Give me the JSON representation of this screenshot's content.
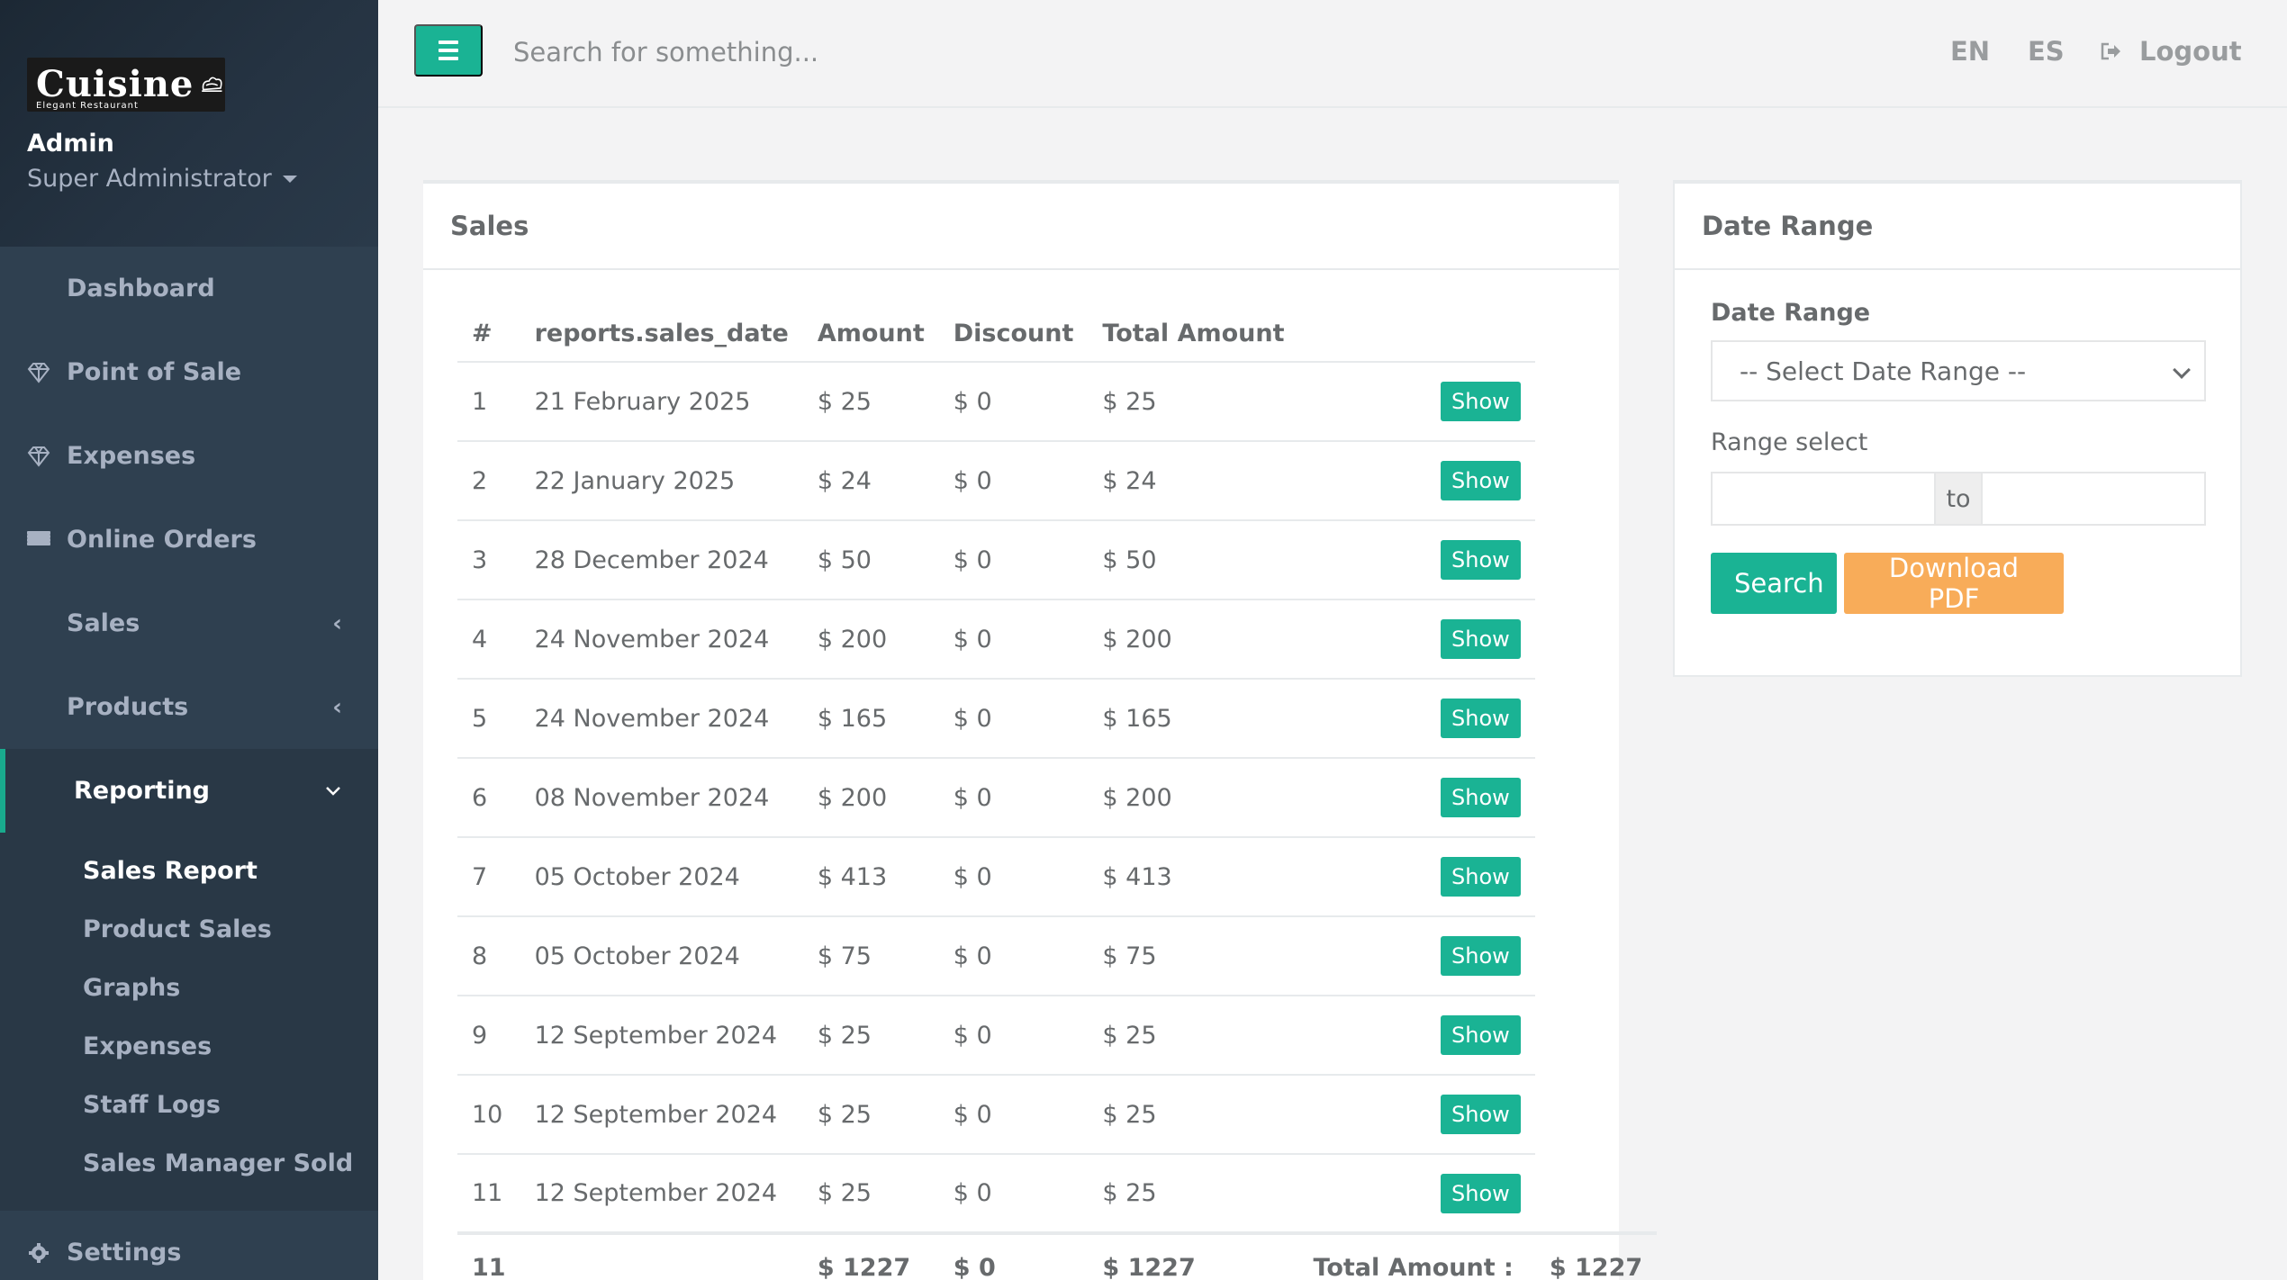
{
  "sidebar": {
    "logo_text": "Cuisine",
    "logo_sub": "Elegant Restaurant",
    "profile_name": "Admin",
    "profile_role": "Super Administrator",
    "nav": [
      {
        "label": "Dashboard",
        "icon": "grid-icon"
      },
      {
        "label": "Point of Sale",
        "icon": "diamond-icon"
      },
      {
        "label": "Expenses",
        "icon": "diamond-icon"
      },
      {
        "label": "Online Orders",
        "icon": "list-icon"
      },
      {
        "label": "Sales",
        "icon": "grid-icon"
      },
      {
        "label": "Products",
        "icon": "grid-icon"
      },
      {
        "label": "Reporting",
        "icon": "grid-icon"
      },
      {
        "label": "Settings",
        "icon": "gear-icon"
      }
    ],
    "reporting_sub": [
      "Sales Report",
      "Product Sales",
      "Graphs",
      "Expenses",
      "Staff Logs",
      "Sales Manager Sold"
    ]
  },
  "topbar": {
    "search_placeholder": "Search for something...",
    "lang_en": "EN",
    "lang_es": "ES",
    "logout": "Logout"
  },
  "sales": {
    "title": "Sales",
    "columns": [
      "#",
      "reports.sales_date",
      "Amount",
      "Discount",
      "Total Amount"
    ],
    "show_label": "Show",
    "rows": [
      {
        "n": "1",
        "date": "21 February 2025",
        "amount": "$ 25",
        "discount": "$ 0",
        "total": "$ 25"
      },
      {
        "n": "2",
        "date": "22 January 2025",
        "amount": "$ 24",
        "discount": "$ 0",
        "total": "$ 24"
      },
      {
        "n": "3",
        "date": "28 December 2024",
        "amount": "$ 50",
        "discount": "$ 0",
        "total": "$ 50"
      },
      {
        "n": "4",
        "date": "24 November 2024",
        "amount": "$ 200",
        "discount": "$ 0",
        "total": "$ 200"
      },
      {
        "n": "5",
        "date": "24 November 2024",
        "amount": "$ 165",
        "discount": "$ 0",
        "total": "$ 165"
      },
      {
        "n": "6",
        "date": "08 November 2024",
        "amount": "$ 200",
        "discount": "$ 0",
        "total": "$ 200"
      },
      {
        "n": "7",
        "date": "05 October 2024",
        "amount": "$ 413",
        "discount": "$ 0",
        "total": "$ 413"
      },
      {
        "n": "8",
        "date": "05 October 2024",
        "amount": "$ 75",
        "discount": "$ 0",
        "total": "$ 75"
      },
      {
        "n": "9",
        "date": "12 September 2024",
        "amount": "$ 25",
        "discount": "$ 0",
        "total": "$ 25"
      },
      {
        "n": "10",
        "date": "12 September 2024",
        "amount": "$ 25",
        "discount": "$ 0",
        "total": "$ 25"
      },
      {
        "n": "11",
        "date": "12 September 2024",
        "amount": "$ 25",
        "discount": "$ 0",
        "total": "$ 25"
      }
    ],
    "totals": {
      "count": "11",
      "amount": "$ 1227",
      "discount": "$ 0",
      "total": "$ 1227",
      "total_label": "Total Amount :",
      "total_value": "$ 1227"
    }
  },
  "date_range": {
    "title": "Date Range",
    "select_label": "Date Range",
    "select_value": "-- Select Date Range --",
    "range_label": "Range select",
    "range_to": "to",
    "search_button": "Search",
    "pdf_button": "Download PDF"
  },
  "colors": {
    "sidebar": "#2f4050",
    "primary": "#1ab394",
    "warning": "#f8ac59"
  }
}
